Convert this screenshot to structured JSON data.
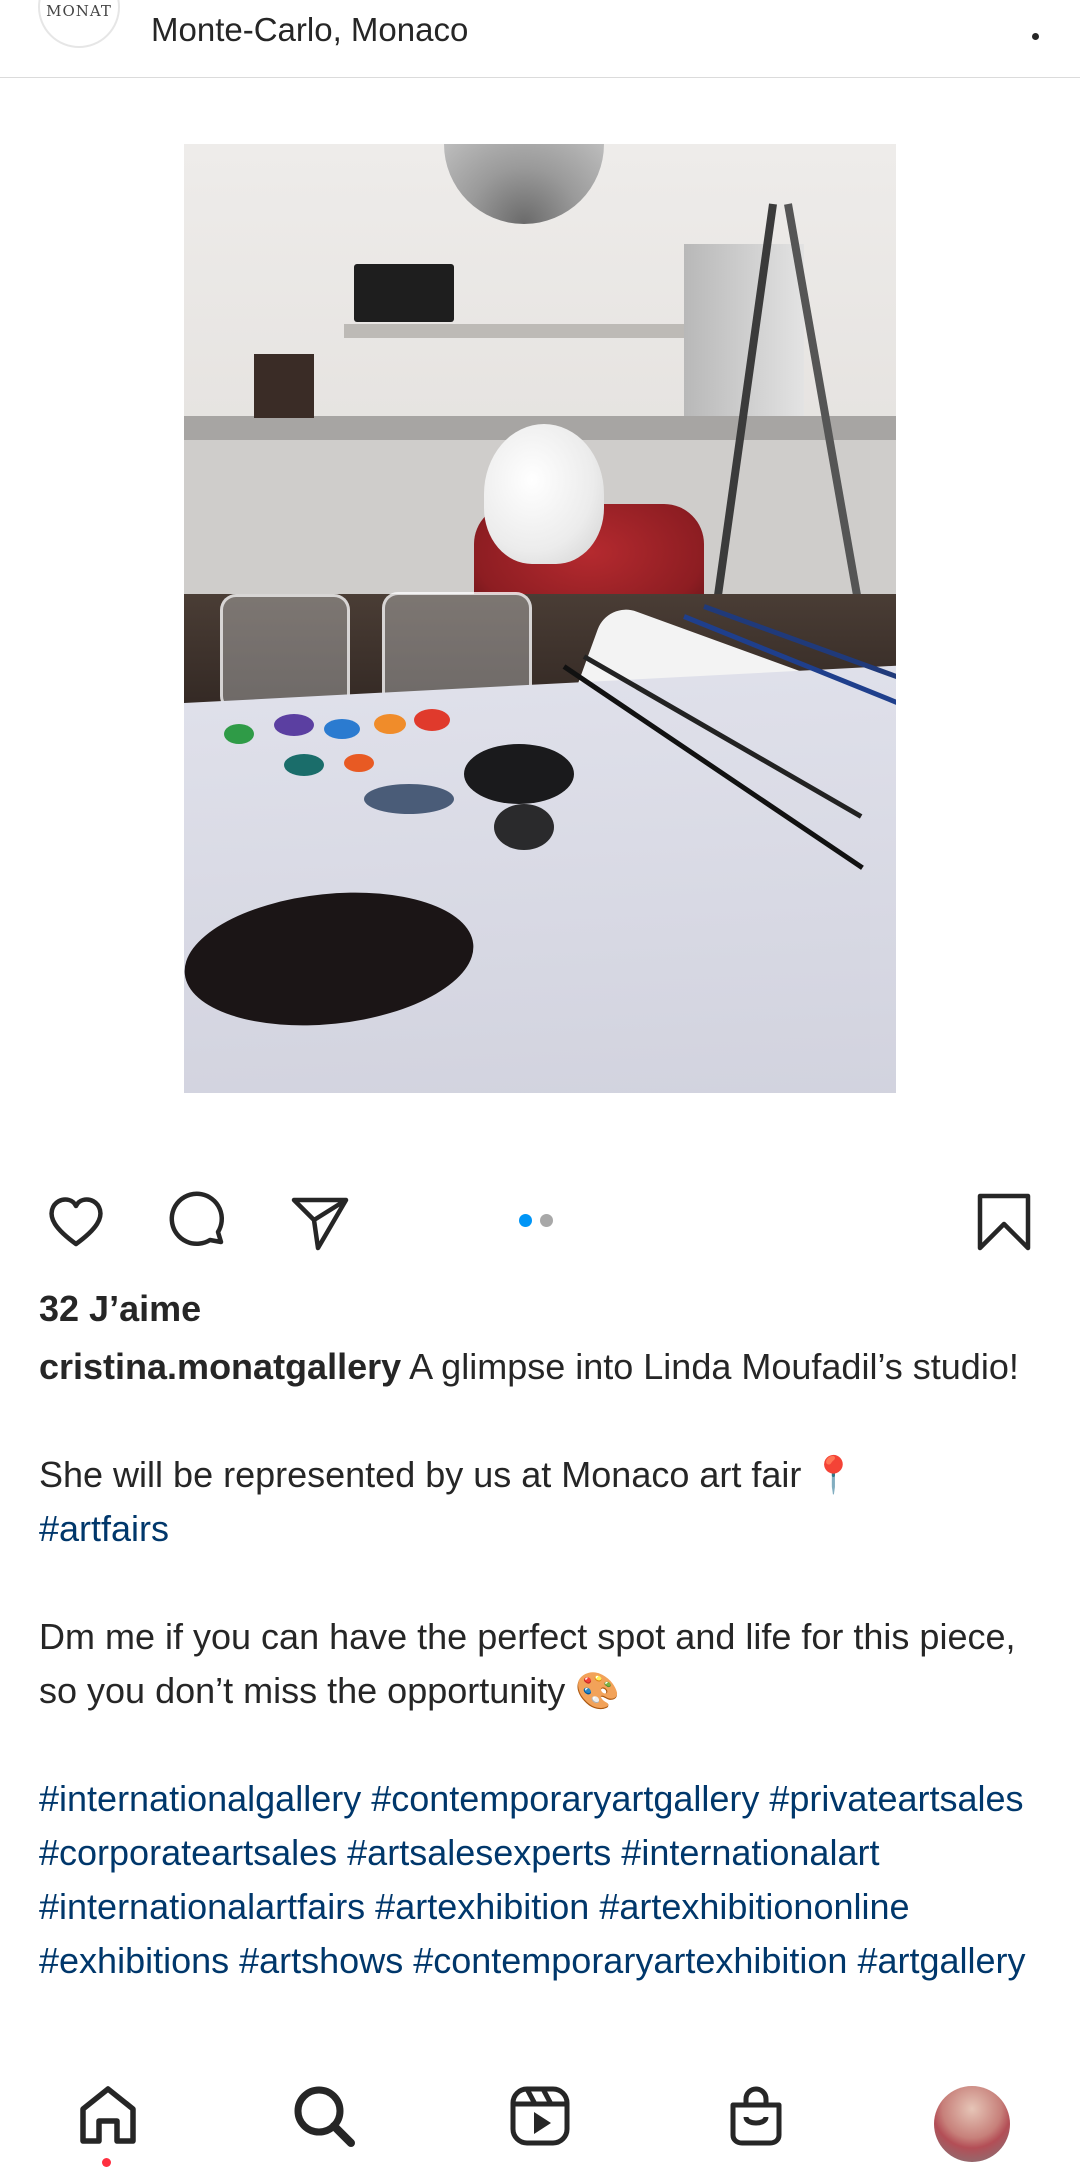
{
  "header": {
    "avatar_text": "MONAT",
    "location": "Monte-Carlo, Monaco",
    "more_icon": "more-vertical-icon"
  },
  "post": {
    "carousel": {
      "count": 2,
      "active": 1
    },
    "likes_label": "32 J’aime",
    "username": "cristina.monatgallery",
    "caption_line1": " A glimpse into Linda Moufadil’s studio!",
    "caption_line2": "She will be represented by us at Monaco art fair 📍",
    "caption_tag1": "#artfairs",
    "caption_line3": "Dm me if you can have the perfect spot and life for this piece, so you don’t miss the opportunity 🎨",
    "hashtags": "#internationalgallery #contemporaryartgallery #privateartsales #corporateartsales #artsalesexperts #internationalart #internationalartfairs #artexhibition #artexhibitiononline #exhibitions #artshows #contemporaryartexhibition #artgallery"
  },
  "actions": {
    "like_icon": "heart-icon",
    "comment_icon": "comment-icon",
    "share_icon": "send-icon",
    "save_icon": "bookmark-icon"
  },
  "nav": {
    "items": [
      "home-icon",
      "search-icon",
      "reels-icon",
      "shop-icon",
      "profile-avatar"
    ]
  },
  "colors": {
    "accent": "#0095f6",
    "hashtag": "#00376b",
    "notification": "#ff3040",
    "text": "#262626"
  }
}
